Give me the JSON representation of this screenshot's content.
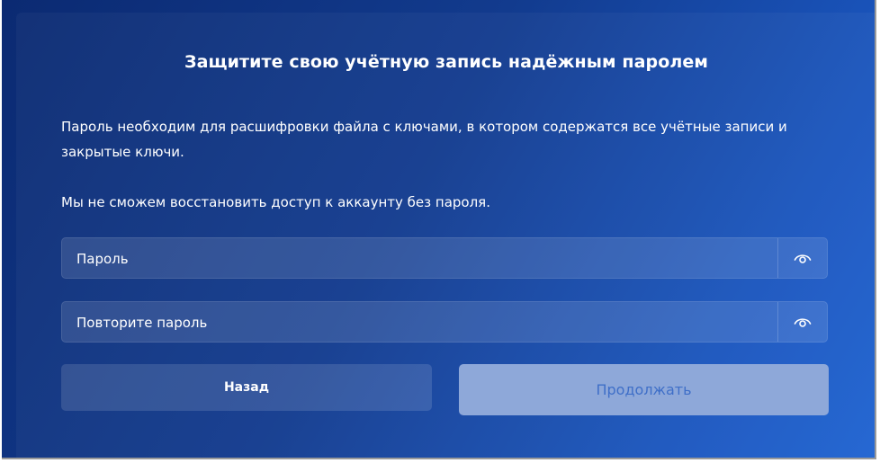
{
  "dialog": {
    "title": "Защитите свою учётную запись надёжным паролем",
    "description_1": "Пароль необходим для расшифровки файла с ключами, в котором содержатся все учётные записи и закрытые ключи.",
    "description_2": "Мы не сможем восстановить доступ к аккаунту без пароля."
  },
  "form": {
    "password_placeholder": "Пароль",
    "repeat_password_placeholder": "Повторите пароль",
    "toggle_icon": "eye-icon"
  },
  "buttons": {
    "back_label": "Назад",
    "continue_label": "Продолжать"
  },
  "colors": {
    "background_start": "#0b2a72",
    "background_end": "#1f63d2",
    "continue_bg": "#8ea8d9",
    "continue_text": "#3f6fc8"
  }
}
